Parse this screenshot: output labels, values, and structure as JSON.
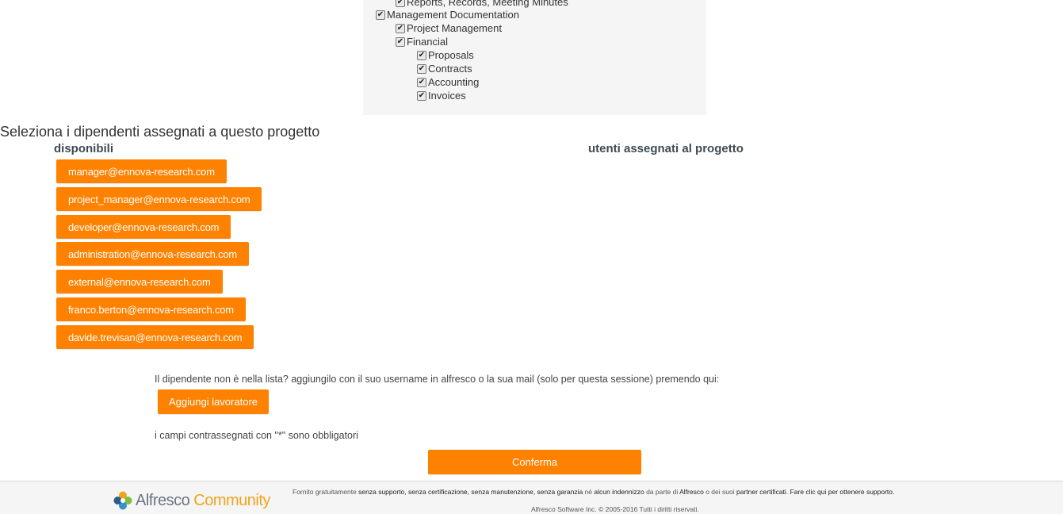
{
  "tree": {
    "items": [
      {
        "label": "Reports, Records, Meeting Minutes",
        "checked": true,
        "level": 1
      },
      {
        "label": "Management Documentation",
        "checked": true,
        "level": 0
      },
      {
        "label": "Project Management",
        "checked": true,
        "level": 1
      },
      {
        "label": "Financial",
        "checked": true,
        "level": 1
      },
      {
        "label": "Proposals",
        "checked": true,
        "level": 2
      },
      {
        "label": "Contracts",
        "checked": true,
        "level": 2
      },
      {
        "label": "Accounting",
        "checked": true,
        "level": 2
      },
      {
        "label": "Invoices",
        "checked": true,
        "level": 2
      }
    ]
  },
  "employees": {
    "section_title": "Seleziona i dipendenti assegnati a questo progetto",
    "available_header": "disponibili",
    "assigned_header": "utenti assegnati al progetto",
    "available": [
      "manager@ennova-research.com",
      "project_manager@ennova-research.com",
      "developer@ennova-research.com",
      "administration@ennova-research.com",
      "external@ennova-research.com",
      "franco.berton@ennova-research.com",
      "davide.trevisan@ennova-research.com"
    ],
    "assigned": []
  },
  "add_worker": {
    "hint": "Il dipendente non è nella lista? aggiungilo con il suo username in alfresco o la sua mail (solo per questa sessione) premendo qui:",
    "button_label": "Aggiungi lavoratore"
  },
  "required_note": "i campi contrassegnati con \"*\" sono obbligatori",
  "confirm_label": "Conferma",
  "footer": {
    "logo_word1": "Alfresco",
    "logo_word2": "Community",
    "line1_a": "Fornito gratuitamente ",
    "line1_b": "senza supporto, senza certificazione, senza manutenzione, senza garanzia",
    "line1_c": " né ",
    "line1_d": "alcun indennizzo",
    "line1_e": " da parte di ",
    "line1_f": "Alfresco",
    "line1_g": " o dei suoi ",
    "line1_h": "partner certificati",
    "line1_i": ". ",
    "line1_j": "Fare clic qui per ottenere supporto.",
    "line2": "Alfresco Software Inc. © 2005-2016 Tutti i diritti riservati."
  },
  "colors": {
    "accent": "#ff8100",
    "logo_gray": "#6b7683",
    "logo_orange": "#f0a41b"
  }
}
